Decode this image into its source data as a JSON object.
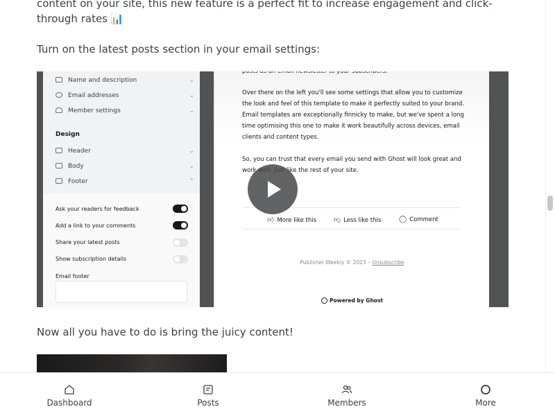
{
  "article": {
    "paragraph1": "content on your site, this new feature is a perfect fit to increase engagement and click-through rates 📊",
    "paragraph2": "Turn on the latest posts section in your email settings:",
    "paragraph3": "Now all you have to do is bring the juicy content!"
  },
  "video": {
    "settings_rows": [
      {
        "label": "Name and description",
        "icon": "text-align-icon"
      },
      {
        "label": "Email addresses",
        "icon": "at-icon"
      },
      {
        "label": "Member settings",
        "icon": "user-icon"
      }
    ],
    "design_heading": "Design",
    "design_rows": [
      {
        "label": "Header",
        "icon": "header-icon"
      },
      {
        "label": "Body",
        "icon": "body-icon"
      },
      {
        "label": "Footer",
        "icon": "footer-icon"
      }
    ],
    "toggles": [
      {
        "label": "Ask your readers for feedback",
        "on": true
      },
      {
        "label": "Add a link to your comments",
        "on": true
      },
      {
        "label": "Share your latest posts",
        "on": false
      },
      {
        "label": "Show subscription details",
        "on": false
      }
    ],
    "email_footer_label": "Email footer",
    "email_line0": "posts as an email newsletter to your subscribers.",
    "email_para1": "Over there on the left you'll see some settings that allow you to customize the look and feel of this template to make it perfectly suited to your brand. Email templates are exceptionally finnicky to make, but we've spent a long time optimising this one to make it work beautifully across devices, email clients and content types.",
    "email_para2": "So, you can trust that every email you send with Ghost will look great and work well. Just like the rest of your site.",
    "actions": {
      "more": "More like this",
      "less": "Less like this",
      "comment": "Comment"
    },
    "footer_text": "Publisher Weekly © 2023 –",
    "unsubscribe": "Unsubscribe",
    "powered": "Powered by Ghost"
  },
  "nav": {
    "dashboard": "Dashboard",
    "posts": "Posts",
    "members": "Members",
    "more": "More"
  }
}
